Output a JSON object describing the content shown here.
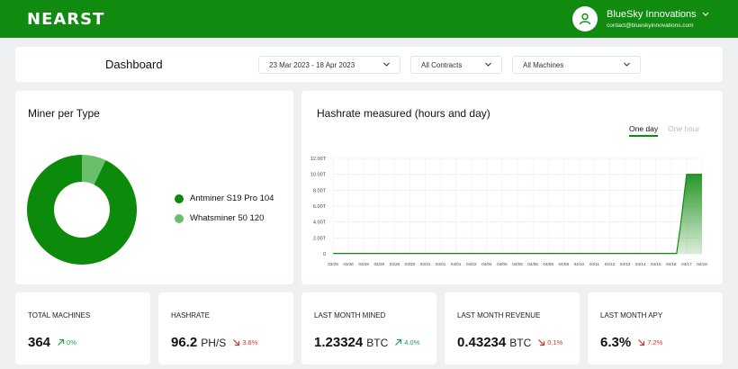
{
  "header": {
    "logo": "NEARST",
    "user_name": "BlueSky Innovations",
    "user_email": "contact@blueskyinnovations.com"
  },
  "toolbar": {
    "title": "Dashboard",
    "date_range": "23 Mar 2023 - 18 Apr 2023",
    "contracts": "All Contracts",
    "machines": "All Machines"
  },
  "miner_card": {
    "title": "Miner per Type",
    "legend": [
      {
        "label": "Antminer S19 Pro 104",
        "value": 104,
        "color": "#0b8a0b"
      },
      {
        "label": "Whatsminer 50 120",
        "value": 8,
        "color": "#6abf6a"
      }
    ]
  },
  "hashrate_card": {
    "title": "Hashrate measured (hours and day)",
    "toggle_day": "One day",
    "toggle_hour": "One hour"
  },
  "chart_data": {
    "type": "area",
    "y_ticks": [
      "0",
      "2.00T",
      "4.00T",
      "6.00T",
      "8.00T",
      "10.00T",
      "12.00T"
    ],
    "ylim": [
      0,
      12
    ],
    "x": [
      "03/25",
      "03/26",
      "03/26",
      "03/28",
      "03/28",
      "03/30",
      "03/31",
      "04/01",
      "04/01",
      "04/02",
      "04/04",
      "04/05",
      "04/06",
      "04/06",
      "04/08",
      "04/09",
      "04/10",
      "04/11",
      "04/12",
      "04/13",
      "04/14",
      "04/15",
      "04/16",
      "04/17",
      "04/18"
    ],
    "values": [
      0.05,
      0.05,
      0.05,
      0.05,
      0.05,
      0.05,
      0.05,
      0.05,
      0.05,
      0.05,
      0.05,
      0.05,
      0.05,
      0.05,
      0.05,
      0.05,
      0.05,
      0.05,
      0.05,
      0.05,
      0.05,
      0.05,
      0.05,
      10,
      10
    ],
    "grid": true
  },
  "stats": [
    {
      "label": "TOTAL MACHINES",
      "value": "364",
      "unit": "",
      "delta": "0%",
      "trend": "up"
    },
    {
      "label": "HASHRATE",
      "value": "96.2",
      "unit": "PH/S",
      "delta": "3.6%",
      "trend": "down"
    },
    {
      "label": "LAST MONTH MINED",
      "value": "1.23324",
      "unit": "BTC",
      "delta": "4.0%",
      "trend": "up"
    },
    {
      "label": "LAST MONTH REVENUE",
      "value": "0.43234",
      "unit": "BTC",
      "delta": "0.1%",
      "trend": "down"
    },
    {
      "label": "LAST MONTH APY",
      "value": "6.3%",
      "unit": "",
      "delta": "7.2%",
      "trend": "down"
    }
  ],
  "colors": {
    "brand": "#118a10",
    "up": "#1f9d55",
    "down": "#d9342b"
  }
}
